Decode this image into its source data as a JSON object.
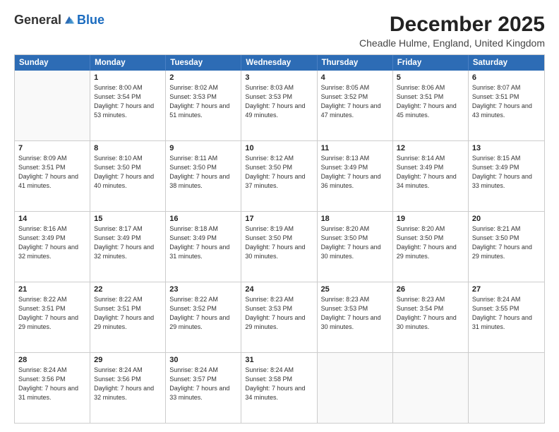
{
  "header": {
    "logo_general": "General",
    "logo_blue": "Blue",
    "title": "December 2025",
    "subtitle": "Cheadle Hulme, England, United Kingdom"
  },
  "calendar": {
    "days": [
      "Sunday",
      "Monday",
      "Tuesday",
      "Wednesday",
      "Thursday",
      "Friday",
      "Saturday"
    ],
    "rows": [
      [
        {
          "day": "",
          "empty": true
        },
        {
          "day": "1",
          "sunrise": "Sunrise: 8:00 AM",
          "sunset": "Sunset: 3:54 PM",
          "daylight": "Daylight: 7 hours and 53 minutes."
        },
        {
          "day": "2",
          "sunrise": "Sunrise: 8:02 AM",
          "sunset": "Sunset: 3:53 PM",
          "daylight": "Daylight: 7 hours and 51 minutes."
        },
        {
          "day": "3",
          "sunrise": "Sunrise: 8:03 AM",
          "sunset": "Sunset: 3:53 PM",
          "daylight": "Daylight: 7 hours and 49 minutes."
        },
        {
          "day": "4",
          "sunrise": "Sunrise: 8:05 AM",
          "sunset": "Sunset: 3:52 PM",
          "daylight": "Daylight: 7 hours and 47 minutes."
        },
        {
          "day": "5",
          "sunrise": "Sunrise: 8:06 AM",
          "sunset": "Sunset: 3:51 PM",
          "daylight": "Daylight: 7 hours and 45 minutes."
        },
        {
          "day": "6",
          "sunrise": "Sunrise: 8:07 AM",
          "sunset": "Sunset: 3:51 PM",
          "daylight": "Daylight: 7 hours and 43 minutes."
        }
      ],
      [
        {
          "day": "7",
          "sunrise": "Sunrise: 8:09 AM",
          "sunset": "Sunset: 3:51 PM",
          "daylight": "Daylight: 7 hours and 41 minutes."
        },
        {
          "day": "8",
          "sunrise": "Sunrise: 8:10 AM",
          "sunset": "Sunset: 3:50 PM",
          "daylight": "Daylight: 7 hours and 40 minutes."
        },
        {
          "day": "9",
          "sunrise": "Sunrise: 8:11 AM",
          "sunset": "Sunset: 3:50 PM",
          "daylight": "Daylight: 7 hours and 38 minutes."
        },
        {
          "day": "10",
          "sunrise": "Sunrise: 8:12 AM",
          "sunset": "Sunset: 3:50 PM",
          "daylight": "Daylight: 7 hours and 37 minutes."
        },
        {
          "day": "11",
          "sunrise": "Sunrise: 8:13 AM",
          "sunset": "Sunset: 3:49 PM",
          "daylight": "Daylight: 7 hours and 36 minutes."
        },
        {
          "day": "12",
          "sunrise": "Sunrise: 8:14 AM",
          "sunset": "Sunset: 3:49 PM",
          "daylight": "Daylight: 7 hours and 34 minutes."
        },
        {
          "day": "13",
          "sunrise": "Sunrise: 8:15 AM",
          "sunset": "Sunset: 3:49 PM",
          "daylight": "Daylight: 7 hours and 33 minutes."
        }
      ],
      [
        {
          "day": "14",
          "sunrise": "Sunrise: 8:16 AM",
          "sunset": "Sunset: 3:49 PM",
          "daylight": "Daylight: 7 hours and 32 minutes."
        },
        {
          "day": "15",
          "sunrise": "Sunrise: 8:17 AM",
          "sunset": "Sunset: 3:49 PM",
          "daylight": "Daylight: 7 hours and 32 minutes."
        },
        {
          "day": "16",
          "sunrise": "Sunrise: 8:18 AM",
          "sunset": "Sunset: 3:49 PM",
          "daylight": "Daylight: 7 hours and 31 minutes."
        },
        {
          "day": "17",
          "sunrise": "Sunrise: 8:19 AM",
          "sunset": "Sunset: 3:50 PM",
          "daylight": "Daylight: 7 hours and 30 minutes."
        },
        {
          "day": "18",
          "sunrise": "Sunrise: 8:20 AM",
          "sunset": "Sunset: 3:50 PM",
          "daylight": "Daylight: 7 hours and 30 minutes."
        },
        {
          "day": "19",
          "sunrise": "Sunrise: 8:20 AM",
          "sunset": "Sunset: 3:50 PM",
          "daylight": "Daylight: 7 hours and 29 minutes."
        },
        {
          "day": "20",
          "sunrise": "Sunrise: 8:21 AM",
          "sunset": "Sunset: 3:50 PM",
          "daylight": "Daylight: 7 hours and 29 minutes."
        }
      ],
      [
        {
          "day": "21",
          "sunrise": "Sunrise: 8:22 AM",
          "sunset": "Sunset: 3:51 PM",
          "daylight": "Daylight: 7 hours and 29 minutes."
        },
        {
          "day": "22",
          "sunrise": "Sunrise: 8:22 AM",
          "sunset": "Sunset: 3:51 PM",
          "daylight": "Daylight: 7 hours and 29 minutes."
        },
        {
          "day": "23",
          "sunrise": "Sunrise: 8:22 AM",
          "sunset": "Sunset: 3:52 PM",
          "daylight": "Daylight: 7 hours and 29 minutes."
        },
        {
          "day": "24",
          "sunrise": "Sunrise: 8:23 AM",
          "sunset": "Sunset: 3:53 PM",
          "daylight": "Daylight: 7 hours and 29 minutes."
        },
        {
          "day": "25",
          "sunrise": "Sunrise: 8:23 AM",
          "sunset": "Sunset: 3:53 PM",
          "daylight": "Daylight: 7 hours and 30 minutes."
        },
        {
          "day": "26",
          "sunrise": "Sunrise: 8:23 AM",
          "sunset": "Sunset: 3:54 PM",
          "daylight": "Daylight: 7 hours and 30 minutes."
        },
        {
          "day": "27",
          "sunrise": "Sunrise: 8:24 AM",
          "sunset": "Sunset: 3:55 PM",
          "daylight": "Daylight: 7 hours and 31 minutes."
        }
      ],
      [
        {
          "day": "28",
          "sunrise": "Sunrise: 8:24 AM",
          "sunset": "Sunset: 3:56 PM",
          "daylight": "Daylight: 7 hours and 31 minutes."
        },
        {
          "day": "29",
          "sunrise": "Sunrise: 8:24 AM",
          "sunset": "Sunset: 3:56 PM",
          "daylight": "Daylight: 7 hours and 32 minutes."
        },
        {
          "day": "30",
          "sunrise": "Sunrise: 8:24 AM",
          "sunset": "Sunset: 3:57 PM",
          "daylight": "Daylight: 7 hours and 33 minutes."
        },
        {
          "day": "31",
          "sunrise": "Sunrise: 8:24 AM",
          "sunset": "Sunset: 3:58 PM",
          "daylight": "Daylight: 7 hours and 34 minutes."
        },
        {
          "day": "",
          "empty": true
        },
        {
          "day": "",
          "empty": true
        },
        {
          "day": "",
          "empty": true
        }
      ]
    ]
  }
}
